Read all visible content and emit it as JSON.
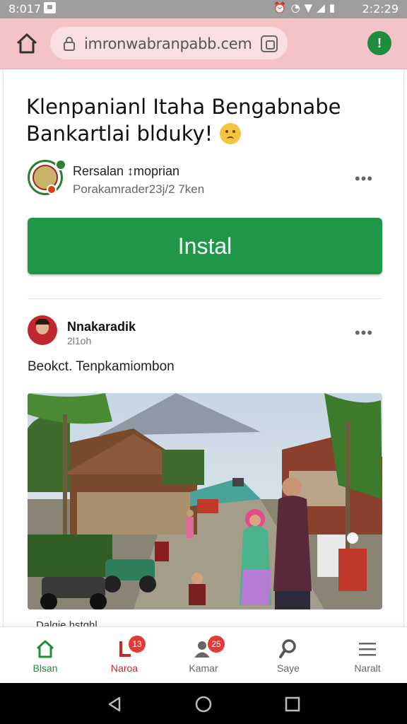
{
  "status_bar": {
    "time": "8:017",
    "clock": "2:2:29"
  },
  "browser": {
    "url": "imronwabranpabb.cem"
  },
  "post_header": {
    "headline_line1": "Klenpanianl Itaha  Bengabnabe",
    "headline_line2": "Bankartlai blduky!",
    "app_name": "Rersalan ↕moprian",
    "app_sub": "Porakamrader23j/2 7ken",
    "install_label": "Instal"
  },
  "post": {
    "author": "Nnakaradik",
    "time": "2l1oh",
    "text": "Beokct. Tenpkamiombon",
    "caption": "Dalgie hstghl"
  },
  "bottom_nav": {
    "items": [
      {
        "label": "Blsan",
        "icon": "home-icon",
        "badge": "",
        "active": true
      },
      {
        "label": "Naroa",
        "icon": "notification-icon",
        "badge": "13",
        "active": false
      },
      {
        "label": "Kamar",
        "icon": "profile-icon",
        "badge": "25",
        "active": false
      },
      {
        "label": "Saye",
        "icon": "search-icon",
        "badge": "",
        "active": false
      },
      {
        "label": "Naralt",
        "icon": "menu-icon",
        "badge": "",
        "active": false
      }
    ]
  },
  "colors": {
    "accent": "#209648",
    "url_bar": "#f4c3c7",
    "badge": "#e53935",
    "active_nav_label": "#c62828"
  }
}
